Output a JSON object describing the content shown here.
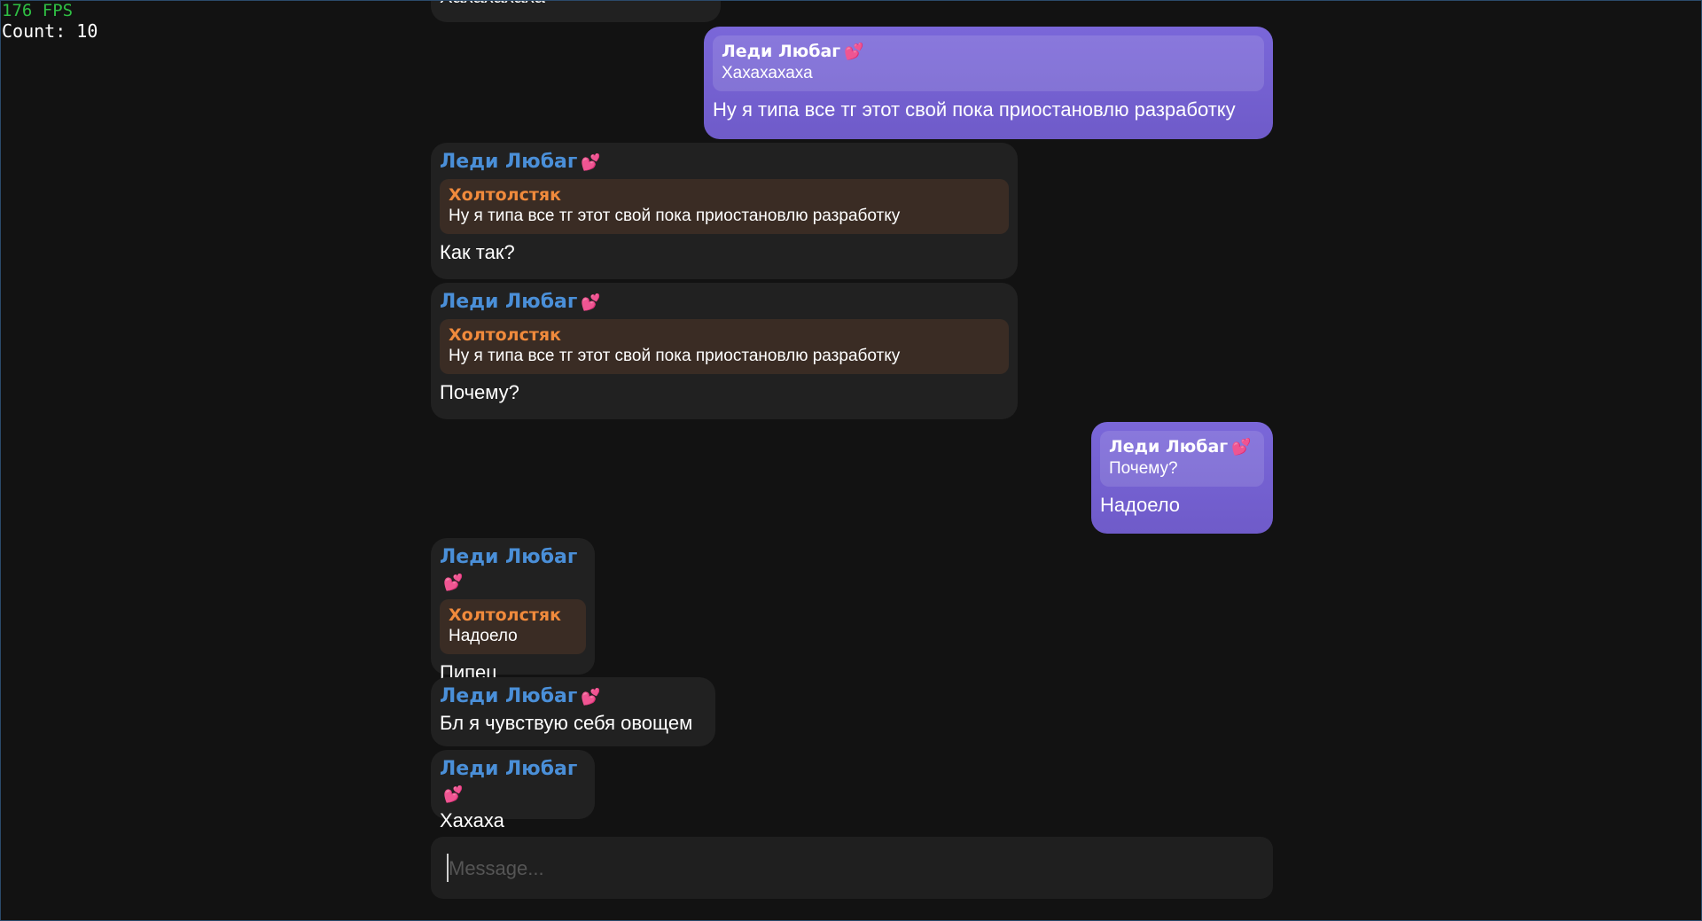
{
  "hud": {
    "fps": "176 FPS",
    "count": "Count: 10"
  },
  "chat": {
    "messages": [
      {
        "direction": "in",
        "text": "Хахахахаха"
      },
      {
        "direction": "out",
        "reply_name": "Леди Любаг",
        "reply_emoji": "💕",
        "reply_text": "Хахахахаха",
        "text": "Ну я типа все тг этот свой пока приостановлю разработку"
      },
      {
        "direction": "in",
        "sender": "Леди Любаг",
        "emoji": "💕",
        "reply_name": "Холтолстяк",
        "reply_text": "Ну я типа все тг этот свой пока приостановлю разработку",
        "text": "Как так?"
      },
      {
        "direction": "in",
        "sender": "Леди Любаг",
        "emoji": "💕",
        "reply_name": "Холтолстяк",
        "reply_text": "Ну я типа все тг этот свой пока приостановлю разработку",
        "text": "Почему?"
      },
      {
        "direction": "out",
        "reply_name": "Леди Любаг",
        "reply_emoji": "💕",
        "reply_text": "Почему?",
        "text": "Надоело"
      },
      {
        "direction": "in",
        "sender": "Леди Любаг",
        "emoji": "💕",
        "reply_name": "Холтолстяк",
        "reply_text": "Надоело",
        "text": "Пипец"
      },
      {
        "direction": "in",
        "sender": "Леди Любаг",
        "emoji": "💕",
        "text": "Бл я чувствую себя овощем"
      },
      {
        "direction": "in",
        "sender": "Леди Любаг",
        "emoji": "💕",
        "text": "Хахаха"
      }
    ]
  },
  "composer": {
    "placeholder": "Message..."
  },
  "colors": {
    "background": "#121212",
    "incoming_bubble": "#212121",
    "outgoing_bubble": "#7a67d9",
    "sender_name": "#4a8fd8",
    "reply_name": "#f08a3c",
    "reply_bg": "#3a2c24",
    "fps_text": "#2fbf43"
  }
}
